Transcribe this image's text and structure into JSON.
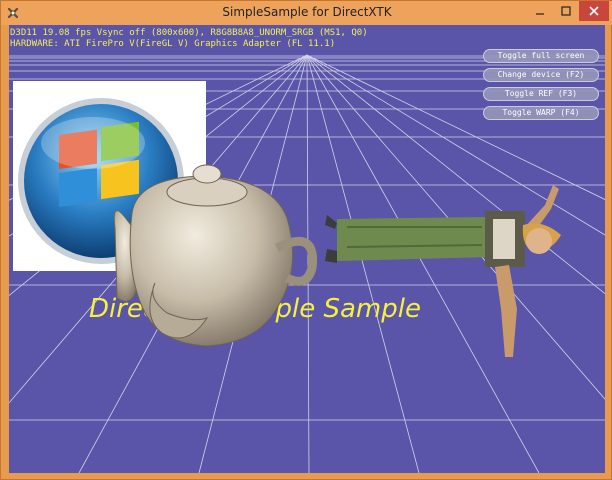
{
  "window": {
    "title": "SimpleSample for DirectXTK"
  },
  "overlay": {
    "stats_line1": "D3D11 19.08 fps Vsync off (800x600), R8G8B8A8_UNORM_SRGB (MS1, Q0)",
    "stats_line2": "HARDWARE: ATI FirePro V(FireGL V) Graphics Adapter (FL 11.1)"
  },
  "buttons": [
    {
      "label": "Toggle full screen"
    },
    {
      "label": "Change device (F2)"
    },
    {
      "label": "Toggle REF (F3)"
    },
    {
      "label": "Toggle WARP (F4)"
    }
  ],
  "scene": {
    "caption": "DirectXTK Simple Sample"
  },
  "colors": {
    "background": "#5a55a8",
    "text": "#f2f05a",
    "titlebar": "#eea35c"
  }
}
